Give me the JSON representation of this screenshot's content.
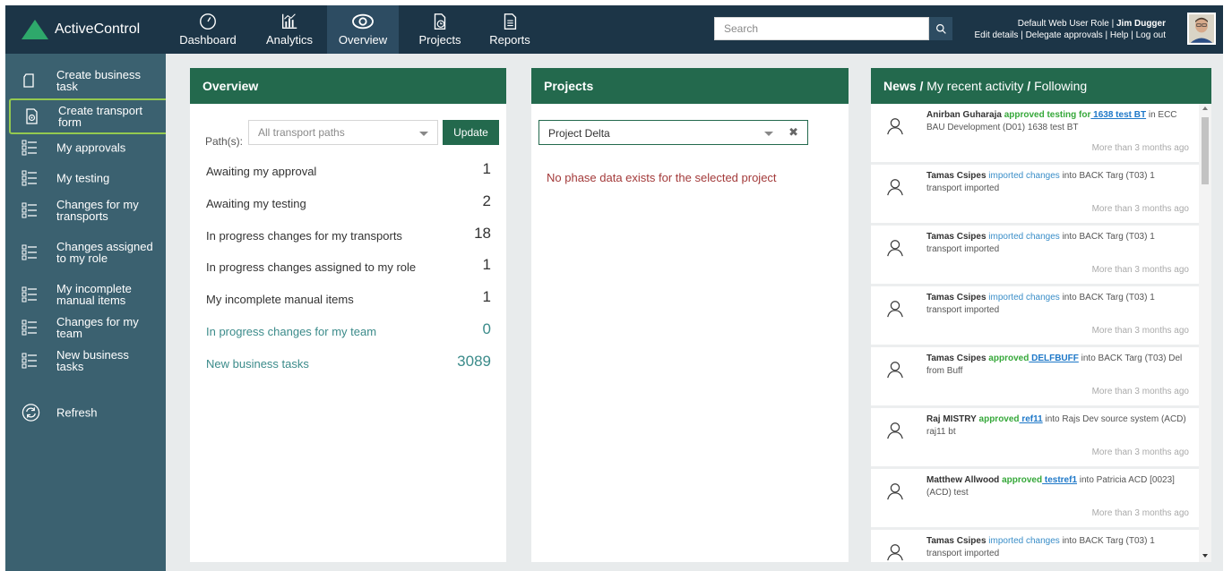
{
  "brand": {
    "name": "ActiveControl"
  },
  "nav": [
    {
      "label": "Dashboard",
      "icon": "gauge-icon"
    },
    {
      "label": "Analytics",
      "icon": "bar-chart-icon"
    },
    {
      "label": "Overview",
      "icon": "eye-icon"
    },
    {
      "label": "Projects",
      "icon": "project-clock-icon"
    },
    {
      "label": "Reports",
      "icon": "document-icon"
    }
  ],
  "search": {
    "placeholder": "Search"
  },
  "user": {
    "role": "Default Web User Role",
    "name": "Jim Dugger",
    "links": [
      "Edit details",
      "Delegate approvals",
      "Help",
      "Log out"
    ]
  },
  "sidebar": {
    "items": [
      {
        "label": "Create business task",
        "icon": "page-icon"
      },
      {
        "label": "Create transport form",
        "icon": "form-gear-icon"
      },
      {
        "label": "My approvals",
        "icon": "checklist-icon"
      },
      {
        "label": "My testing",
        "icon": "checklist-icon"
      },
      {
        "label": "Changes for my transports",
        "icon": "checklist-icon"
      },
      {
        "label": "Changes assigned to my role",
        "icon": "checklist-icon"
      },
      {
        "label": "My incomplete manual items",
        "icon": "checklist-icon"
      },
      {
        "label": "Changes for my team",
        "icon": "checklist-icon"
      },
      {
        "label": "New business tasks",
        "icon": "checklist-icon"
      },
      {
        "label": "Refresh",
        "icon": "refresh-icon"
      }
    ]
  },
  "overview": {
    "title": "Overview",
    "paths_label": "Path(s):",
    "paths_placeholder": "All transport paths",
    "update_label": "Update",
    "rows": [
      {
        "label": "Awaiting my approval",
        "count": "1"
      },
      {
        "label": "Awaiting my testing",
        "count": "2"
      },
      {
        "label": "In progress changes for my transports",
        "count": "18"
      },
      {
        "label": "In progress changes assigned to my role",
        "count": "1"
      },
      {
        "label": "My incomplete manual items",
        "count": "1"
      },
      {
        "label": "In progress changes for my team",
        "count": "0"
      },
      {
        "label": "New business tasks",
        "count": "3089"
      }
    ]
  },
  "projects": {
    "title": "Projects",
    "selected": "Project Delta",
    "message": "No phase data exists for the selected project"
  },
  "news": {
    "title_news": "News",
    "title_sep": "/",
    "title_recent": "My recent activity",
    "title_following": "Following",
    "items": [
      {
        "who": "Anirban Guharaja",
        "action": "approved testing for",
        "link": " 1638 test BT",
        "rest": " in ECC BAU Development (D01) 1638 test BT",
        "time": "More than 3 months ago"
      },
      {
        "who": "Tamas Csipes",
        "action": "imported changes",
        "link": "",
        "rest": " into BACK Targ (T03) 1 transport imported",
        "time": "More than 3 months ago"
      },
      {
        "who": "Tamas Csipes",
        "action": "imported changes",
        "link": "",
        "rest": " into BACK Targ (T03) 1 transport imported",
        "time": "More than 3 months ago"
      },
      {
        "who": "Tamas Csipes",
        "action": "imported changes",
        "link": "",
        "rest": " into BACK Targ (T03) 1 transport imported",
        "time": "More than 3 months ago"
      },
      {
        "who": "Tamas Csipes",
        "action": "approved",
        "link": " DELFBUFF",
        "rest": " into BACK Targ (T03) Del from Buff",
        "time": "More than 3 months ago"
      },
      {
        "who": "Raj MISTRY",
        "action": "approved",
        "link": " ref11",
        "rest": " into Rajs Dev source system (ACD) raj11 bt",
        "time": "More than 3 months ago"
      },
      {
        "who": "Matthew Allwood",
        "action": "approved",
        "link": " testref1",
        "rest": " into Patricia ACD [0023] (ACD) test",
        "time": "More than 3 months ago"
      },
      {
        "who": "Tamas Csipes",
        "action": "imported changes",
        "link": "",
        "rest": " into BACK Targ (T03) 1 transport imported",
        "time": ""
      }
    ]
  },
  "colors": {
    "topbar": "#1c3547",
    "sidebar": "#3b6170",
    "panel_header": "#23694d",
    "brand_logo": "#2ea86b",
    "highlight": "#94c950"
  }
}
